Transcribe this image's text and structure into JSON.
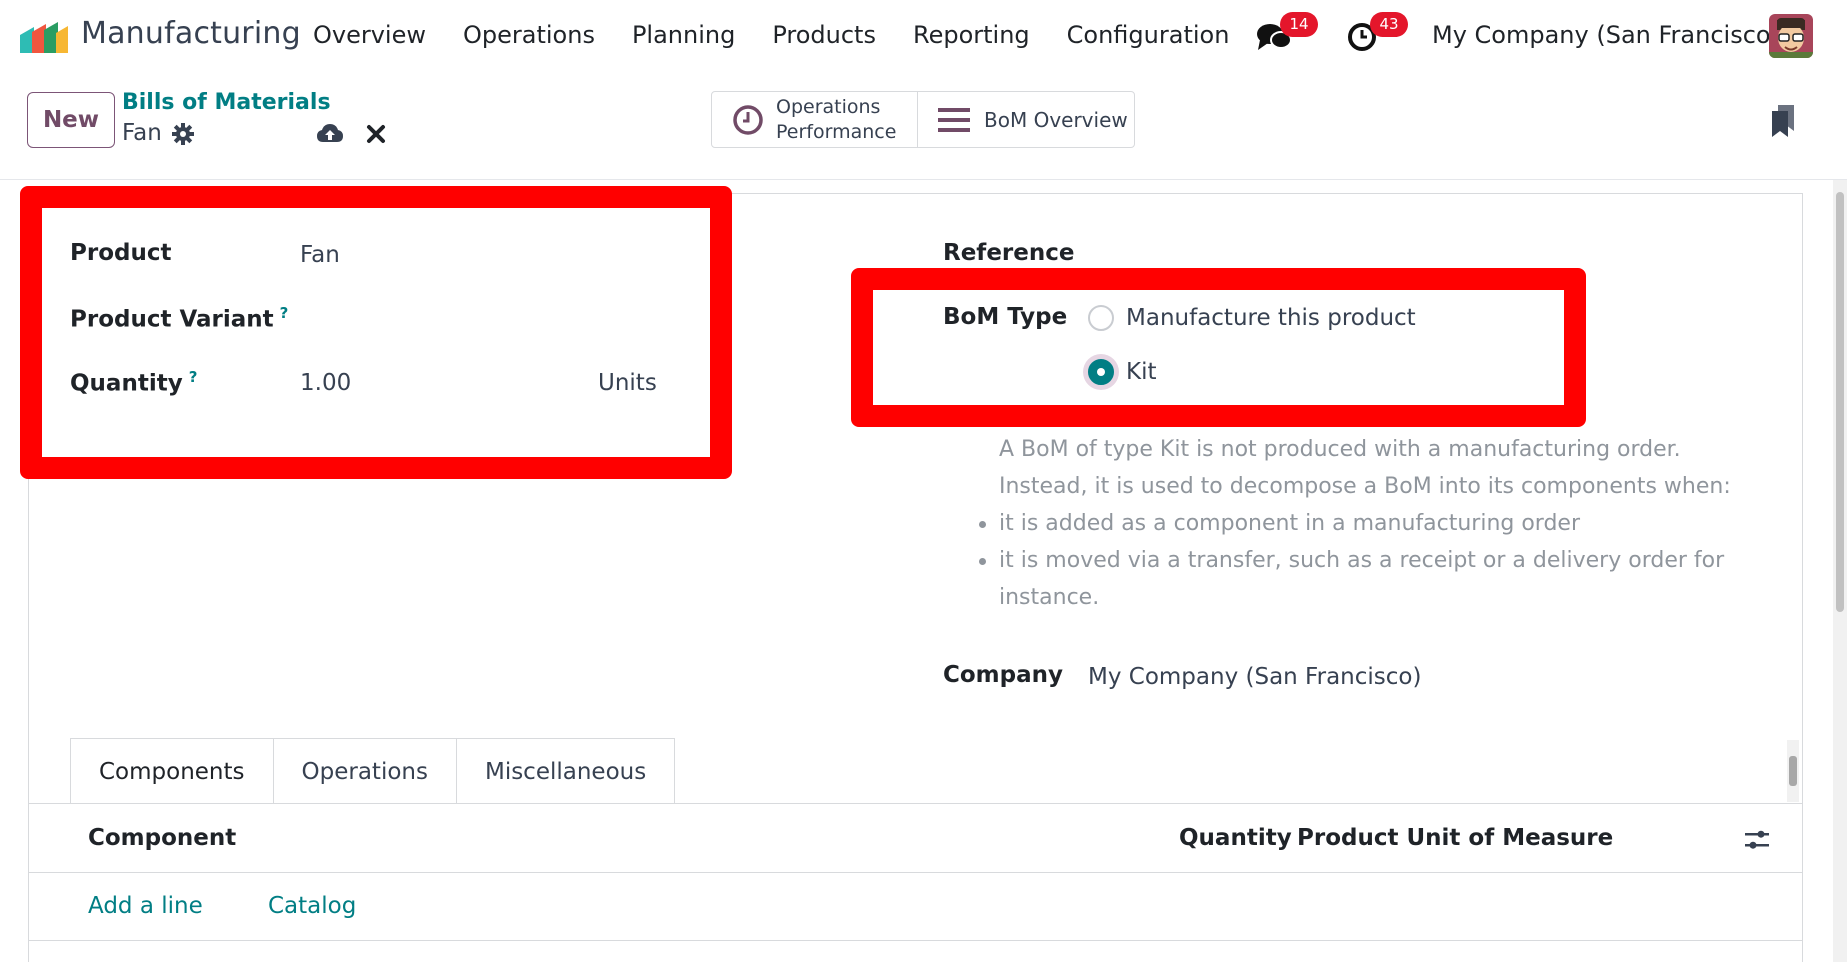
{
  "navbar": {
    "app_name": "Manufacturing",
    "menu": [
      "Overview",
      "Operations",
      "Planning",
      "Products",
      "Reporting",
      "Configuration"
    ],
    "messages_count": "14",
    "activities_count": "43",
    "company": "My Company (San Francisco)"
  },
  "control_panel": {
    "new_label": "New",
    "breadcrumb_parent": "Bills of Materials",
    "breadcrumb_record": "Fan",
    "smart_buttons": {
      "operations_performance_line1": "Operations",
      "operations_performance_line2": "Performance",
      "bom_overview": "BoM Overview"
    }
  },
  "form": {
    "product_label": "Product",
    "product_value": "Fan",
    "variant_label": "Product Variant",
    "quantity_label": "Quantity",
    "quantity_value": "1.00",
    "uom_value": "Units",
    "help_mark": "?",
    "reference_label": "Reference",
    "bom_type_label": "BoM Type",
    "bom_type_options": [
      {
        "label": "Manufacture this product",
        "selected": false
      },
      {
        "label": "Kit",
        "selected": true
      }
    ],
    "kit_help_line1": "A BoM of type Kit is not produced with a manufacturing order.",
    "kit_help_line2": "Instead, it is used to decompose a BoM into its components when:",
    "kit_help_bullets": [
      "it is added as a component in a manufacturing order",
      "it is moved via a transfer, such as a receipt or a delivery order for",
      "instance."
    ],
    "company_label": "Company",
    "company_value": "My Company (San Francisco)"
  },
  "tabs": [
    "Components",
    "Operations",
    "Miscellaneous"
  ],
  "components_table": {
    "col_component": "Component",
    "col_quantity": "Quantity",
    "col_uom": "Product Unit of Measure",
    "add_line": "Add a line",
    "catalog": "Catalog"
  },
  "colors": {
    "brand": "#714b67",
    "accent": "#017e84",
    "highlight": "#ff0000",
    "badge": "#e4162b"
  },
  "icons": [
    "app-logo-icon",
    "chat-icon",
    "clock-icon",
    "gear-icon",
    "cloud-upload-icon",
    "close-icon",
    "clock-icon",
    "list-icon",
    "bookmark-icon",
    "sliders-icon"
  ]
}
